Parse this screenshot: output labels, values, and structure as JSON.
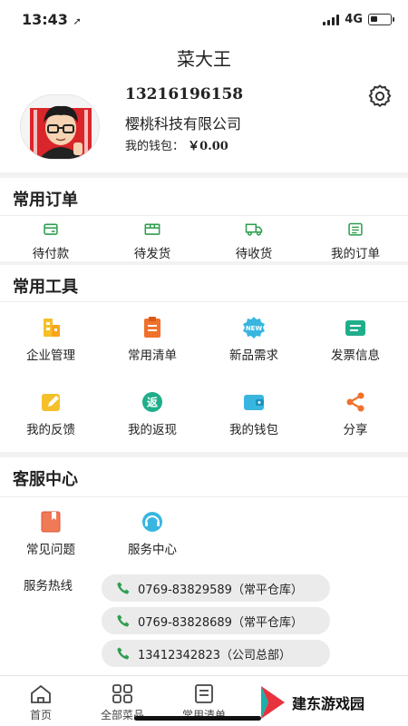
{
  "status_bar": {
    "time": "13:43",
    "network": "4G"
  },
  "header": {
    "title": "菜大王",
    "phone": "13216196158",
    "company": "樱桃科技有限公司",
    "wallet_label": "我的钱包：",
    "wallet_value": "￥0.00"
  },
  "orders": {
    "title": "常用订单",
    "items": [
      {
        "label": "待付款",
        "icon": "wallet-card-icon"
      },
      {
        "label": "待发货",
        "icon": "box-icon"
      },
      {
        "label": "待收货",
        "icon": "truck-icon"
      },
      {
        "label": "我的订单",
        "icon": "order-list-icon"
      }
    ]
  },
  "tools": {
    "title": "常用工具",
    "items": [
      {
        "label": "企业管理",
        "icon": "enterprise-icon"
      },
      {
        "label": "常用清单",
        "icon": "clipboard-icon"
      },
      {
        "label": "新品需求",
        "icon": "new-badge-icon"
      },
      {
        "label": "发票信息",
        "icon": "invoice-icon"
      },
      {
        "label": "我的反馈",
        "icon": "feedback-edit-icon"
      },
      {
        "label": "我的返现",
        "icon": "cashback-icon"
      },
      {
        "label": "我的钱包",
        "icon": "wallet-icon"
      },
      {
        "label": "分享",
        "icon": "share-icon"
      }
    ]
  },
  "service": {
    "title": "客服中心",
    "items": [
      {
        "label": "常见问题",
        "icon": "faq-book-icon"
      },
      {
        "label": "服务中心",
        "icon": "headset-icon"
      }
    ],
    "hotline_label": "服务热线",
    "hotlines": [
      "0769-83829589（常平仓库）",
      "0769-83828689（常平仓库）",
      "13412342823（公司总部）"
    ]
  },
  "tabbar": {
    "items": [
      {
        "label": "首页",
        "icon": "home-icon"
      },
      {
        "label": "全部菜品",
        "icon": "grid-icon"
      },
      {
        "label": "常用清单",
        "icon": "list-icon"
      }
    ]
  },
  "watermark": {
    "text": "建东游戏园"
  },
  "colors": {
    "green": "#2f9e4f",
    "orange": "#f0712b",
    "yellow": "#f5c02a",
    "cyan": "#38b6e0"
  }
}
